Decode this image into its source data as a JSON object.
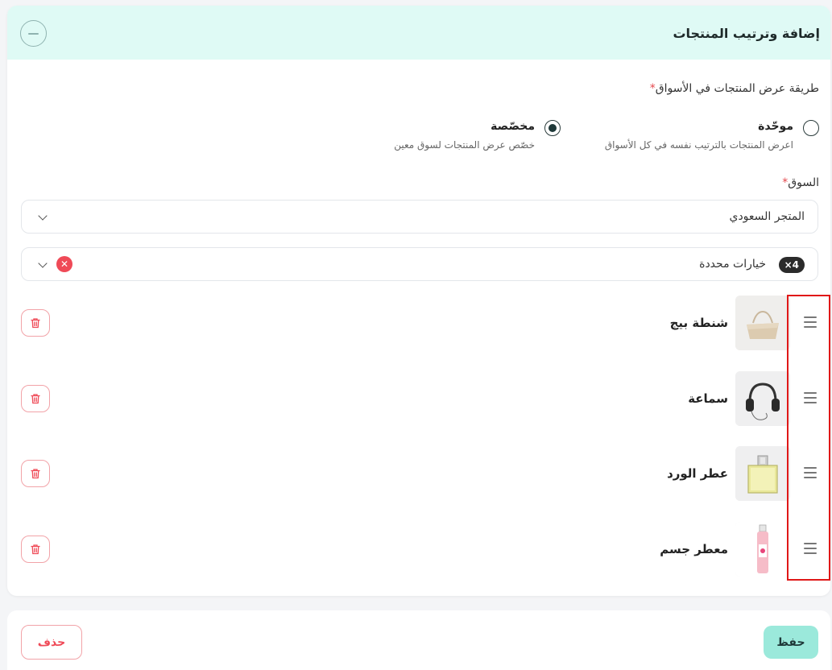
{
  "panel": {
    "title": "إضافة وترتيب المنتجات"
  },
  "display_method": {
    "label": "طريقة عرض المنتجات في الأسواق",
    "required_mark": "*",
    "options": [
      {
        "title": "موحّدة",
        "description": "اعرض المنتجات بالترتيب نفسه في كل الأسواق",
        "selected": false
      },
      {
        "title": "مخصّصة",
        "description": "خصّص عرض المنتجات لسوق معين",
        "selected": true
      }
    ]
  },
  "market": {
    "label": "السوق",
    "required_mark": "*",
    "selected_value": "المتجر السعودي"
  },
  "options_select": {
    "count_badge": "×4",
    "value": "خيارات محددة"
  },
  "products": [
    {
      "name": "شنطة بيج",
      "image": "beige-bag"
    },
    {
      "name": "سماعة",
      "image": "headphones"
    },
    {
      "name": "عطر الورد",
      "image": "perfume-bottle"
    },
    {
      "name": "معطر جسم",
      "image": "body-mist"
    }
  ],
  "footer": {
    "save_label": "حفظ",
    "delete_label": "حذف"
  },
  "colors": {
    "header_bg": "#dffaf5",
    "save_bg": "#9be9db",
    "danger": "#ef4a57",
    "highlight": "#e01818"
  }
}
